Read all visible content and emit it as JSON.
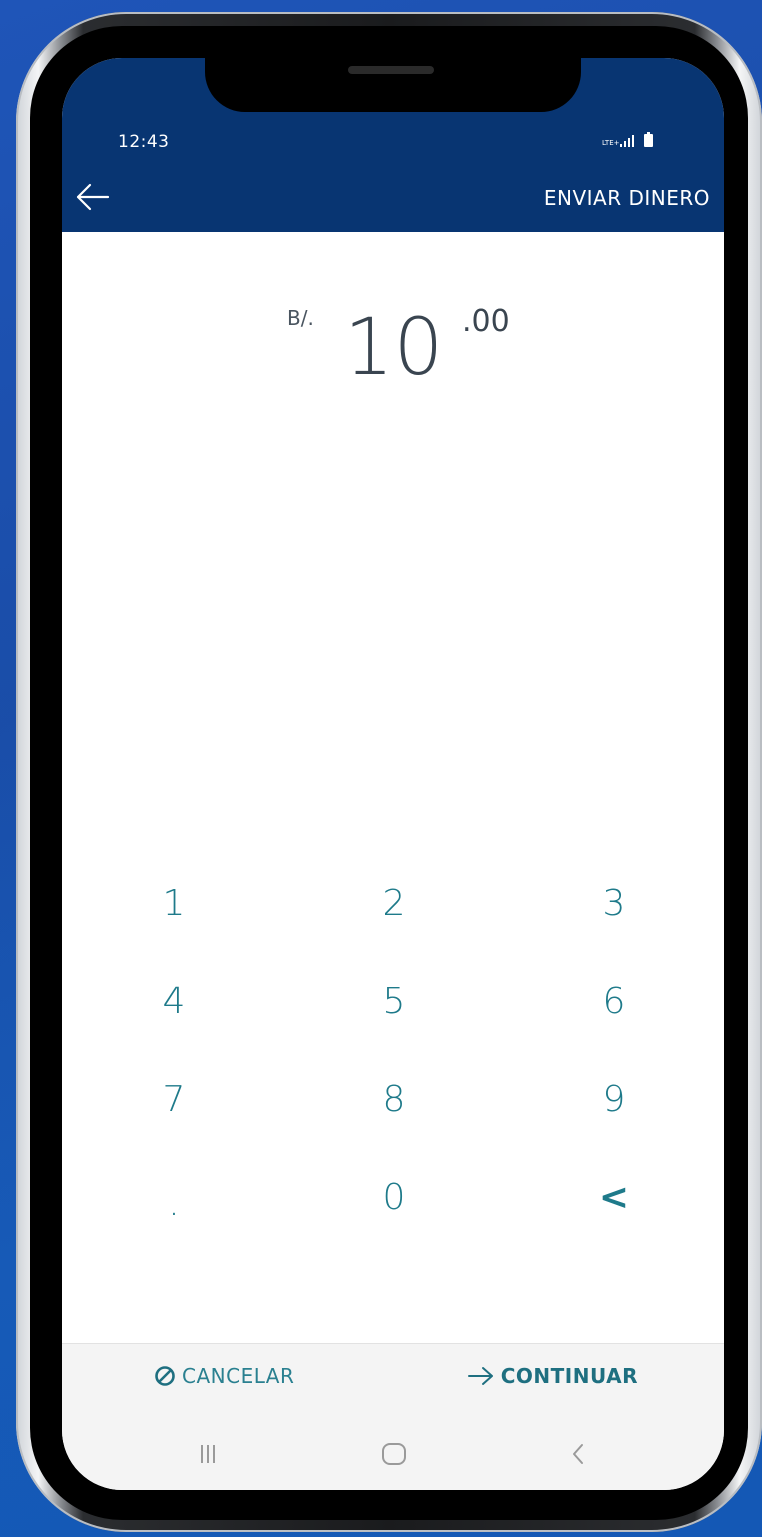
{
  "status_bar": {
    "time": "12:43",
    "network": "LTE+"
  },
  "header": {
    "title": "ENVIAR DINERO"
  },
  "amount": {
    "currency": "B/.",
    "integer": "10",
    "decimals": ".00"
  },
  "keypad": {
    "keys": [
      "1",
      "2",
      "3",
      "4",
      "5",
      "6",
      "7",
      "8",
      "9",
      ".",
      "0",
      "<"
    ]
  },
  "actions": {
    "cancel_label": "CANCELAR",
    "continue_label": "CONTINUAR"
  },
  "colors": {
    "header_bg": "#083572",
    "accent": "#1e7a8a",
    "background": "#1f55b8"
  },
  "icons": {
    "back": "arrow-left-icon",
    "cancel": "prohibited-icon",
    "continue": "arrow-right-icon",
    "nav_recent": "recent-apps-icon",
    "nav_home": "home-icon",
    "nav_back": "nav-back-icon"
  }
}
